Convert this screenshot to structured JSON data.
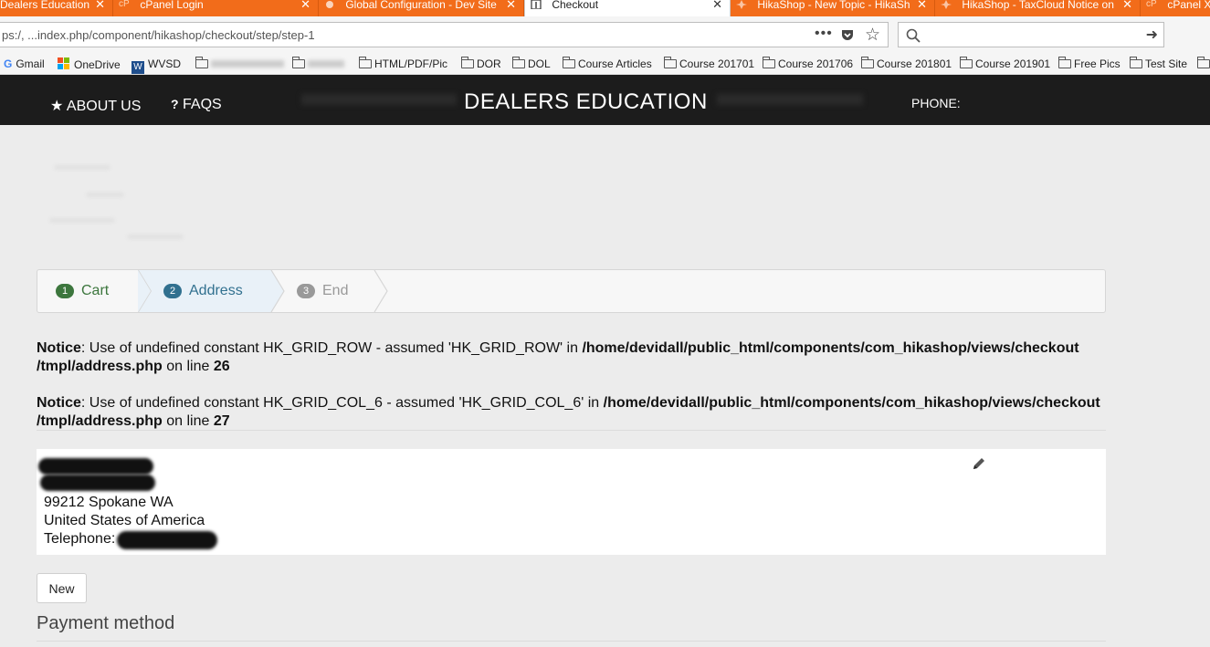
{
  "browser": {
    "tabs": [
      {
        "title": "Dealers Education",
        "active": false
      },
      {
        "title": "cPanel Login",
        "active": false
      },
      {
        "title": "Global Configuration - Dev Site",
        "active": false
      },
      {
        "title": "Checkout",
        "active": true
      },
      {
        "title": "HikaShop - New Topic - HikaSh",
        "active": false
      },
      {
        "title": "HikaShop - TaxCloud Notice on",
        "active": false
      },
      {
        "title": "cPanel X",
        "active": false
      }
    ],
    "close_glyph": "✕",
    "url": "ps:/, ...index.php/component/hikashop/checkout/step/step-1",
    "bookmarks": [
      {
        "label": "Gmail",
        "icon": "google-icon"
      },
      {
        "label": "OneDrive",
        "icon": "microsoft-icon"
      },
      {
        "label": "WVSD",
        "icon": "wvsd-icon"
      },
      {
        "label": "HTML/PDF/Pic",
        "icon": "folder-icon"
      },
      {
        "label": "DOR",
        "icon": "folder-icon"
      },
      {
        "label": "DOL",
        "icon": "folder-icon"
      },
      {
        "label": "Course Articles",
        "icon": "folder-icon"
      },
      {
        "label": "Course 201701",
        "icon": "folder-icon"
      },
      {
        "label": "Course 201706",
        "icon": "folder-icon"
      },
      {
        "label": "Course 201801",
        "icon": "folder-icon"
      },
      {
        "label": "Course 201901",
        "icon": "folder-icon"
      },
      {
        "label": "Free Pics",
        "icon": "folder-icon"
      },
      {
        "label": "Test Site",
        "icon": "folder-icon"
      }
    ]
  },
  "site": {
    "nav": [
      {
        "label": "ABOUT US",
        "icon": "star-icon"
      },
      {
        "label": "FAQS",
        "icon": "question-icon"
      }
    ],
    "brand": "DEALERS EDUCATION",
    "phone_label": "PHONE:"
  },
  "checkout": {
    "steps": [
      {
        "number": "1",
        "label": "Cart",
        "state": "done",
        "color": "#3c763d"
      },
      {
        "number": "2",
        "label": "Address",
        "state": "current",
        "color": "#31708f"
      },
      {
        "number": "3",
        "label": "End",
        "state": "pending",
        "color": "#999999"
      }
    ],
    "notices": [
      {
        "label": "Notice",
        "message": ": Use of undefined constant HK_GRID_ROW - assumed 'HK_GRID_ROW' in ",
        "path": "/home/devidall/public_html/components/com_hikashop/views/checkout /tmpl/address.php",
        "on_line": " on line ",
        "line": "26"
      },
      {
        "label": "Notice",
        "message": ": Use of undefined constant HK_GRID_COL_6 - assumed 'HK_GRID_COL_6' in ",
        "path": "/home/devidall/public_html/components/com_hikashop/views/checkout /tmpl/address.php",
        "on_line": " on line ",
        "line": "27"
      }
    ],
    "address": {
      "city_line": "99212 Spokane WA",
      "country": "United States of America",
      "telephone_label": "Telephone:"
    },
    "new_button": "New",
    "payment_title": "Payment method"
  }
}
